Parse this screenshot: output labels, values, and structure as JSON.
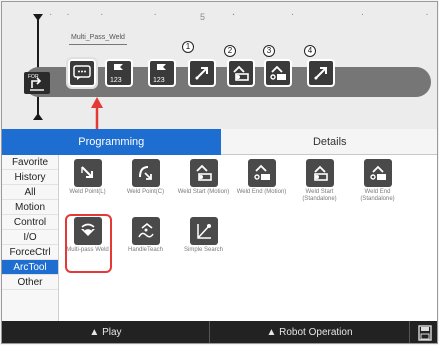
{
  "timeline": {
    "ruler_marker": "5",
    "selected_node_label": "Multi_Pass_Weld",
    "start_node_label": "FOR",
    "numbers": [
      "1",
      "2",
      "3",
      "4"
    ],
    "nodes": [
      {
        "name": "multi-pass-weld-node",
        "icon": "chat-bubble-icon"
      },
      {
        "name": "numeric-node-1",
        "text": "123",
        "icon": "flag-icon"
      },
      {
        "name": "numeric-node-2",
        "text": "123",
        "icon": "flag-icon"
      },
      {
        "name": "weld-point-node",
        "icon": "arrow-icon"
      },
      {
        "name": "weld-start-node",
        "icon": "torch-icon"
      },
      {
        "name": "weld-end-node",
        "icon": "torch-end-icon"
      },
      {
        "name": "move-node",
        "icon": "arrow-icon"
      }
    ]
  },
  "tabs": {
    "programming": "Programming",
    "details": "Details"
  },
  "categories": [
    "Favorite",
    "History",
    "All",
    "Motion",
    "Control",
    "I/O",
    "ForceCtrl",
    "ArcTool",
    "Other"
  ],
  "active_category": "ArcTool",
  "commands": [
    {
      "label": "Weld Point(L)"
    },
    {
      "label": "Weld Point(C)"
    },
    {
      "label": "Weld Start (Motion)"
    },
    {
      "label": "Weld End (Motion)"
    },
    {
      "label": "Weld Start (Standalone)"
    },
    {
      "label": "Weld End (Standalone)"
    },
    {
      "label": "Multi-pass Weld"
    },
    {
      "label": "HandleTeach"
    },
    {
      "label": "Simple Search"
    }
  ],
  "bottom_bar": {
    "play": "▲ Play",
    "robot_operation": "▲ Robot Operation"
  },
  "colors": {
    "accent": "#1e6dd0",
    "highlight": "#e53935",
    "bar": "#222222"
  }
}
